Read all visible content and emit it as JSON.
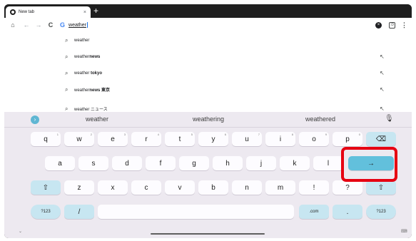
{
  "tab": {
    "title": "New tab",
    "close": "×"
  },
  "new_tab_button": "+",
  "toolbar": {
    "home": "⌂",
    "back": "←",
    "forward": "→",
    "reload": "C",
    "google_icon": "G",
    "omnibox_value": "weather",
    "clear": "×",
    "tabs_count": ":D",
    "menu": "⋮"
  },
  "suggestions": [
    {
      "prefix": "weather",
      "bold": "",
      "has_arrow": false
    },
    {
      "prefix": "weather",
      "bold": "news",
      "has_arrow": true
    },
    {
      "prefix": "weather ",
      "bold": "tokyo",
      "has_arrow": true
    },
    {
      "prefix": "weather",
      "bold": "news 東京",
      "has_arrow": true
    },
    {
      "prefix": "weather ニュース",
      "bold": "",
      "has_arrow": true
    }
  ],
  "suggestion_icon": "⌕",
  "suggestion_arrow": "↖",
  "keyboard": {
    "expand_icon": "›",
    "candidates": [
      "weather",
      "weathering",
      "weathered"
    ],
    "mic": "🎙",
    "row1": [
      {
        "label": "q",
        "hint": "1"
      },
      {
        "label": "w",
        "hint": "2"
      },
      {
        "label": "e",
        "hint": "3"
      },
      {
        "label": "r",
        "hint": "4"
      },
      {
        "label": "t",
        "hint": "5"
      },
      {
        "label": "y",
        "hint": "6"
      },
      {
        "label": "u",
        "hint": "7"
      },
      {
        "label": "i",
        "hint": "8"
      },
      {
        "label": "o",
        "hint": "9"
      },
      {
        "label": "p",
        "hint": "0"
      }
    ],
    "backspace": "⌫",
    "row2": [
      "a",
      "s",
      "d",
      "f",
      "g",
      "h",
      "j",
      "k",
      "l"
    ],
    "enter": "→",
    "shift": "⇧",
    "row3": [
      "z",
      "x",
      "c",
      "v",
      "b",
      "n",
      "m",
      "!",
      "?"
    ],
    "symbols": "?123",
    "slash": "/",
    "dotcom": ".com",
    "period": ".",
    "hide": "⌄",
    "switch": "⌨"
  }
}
